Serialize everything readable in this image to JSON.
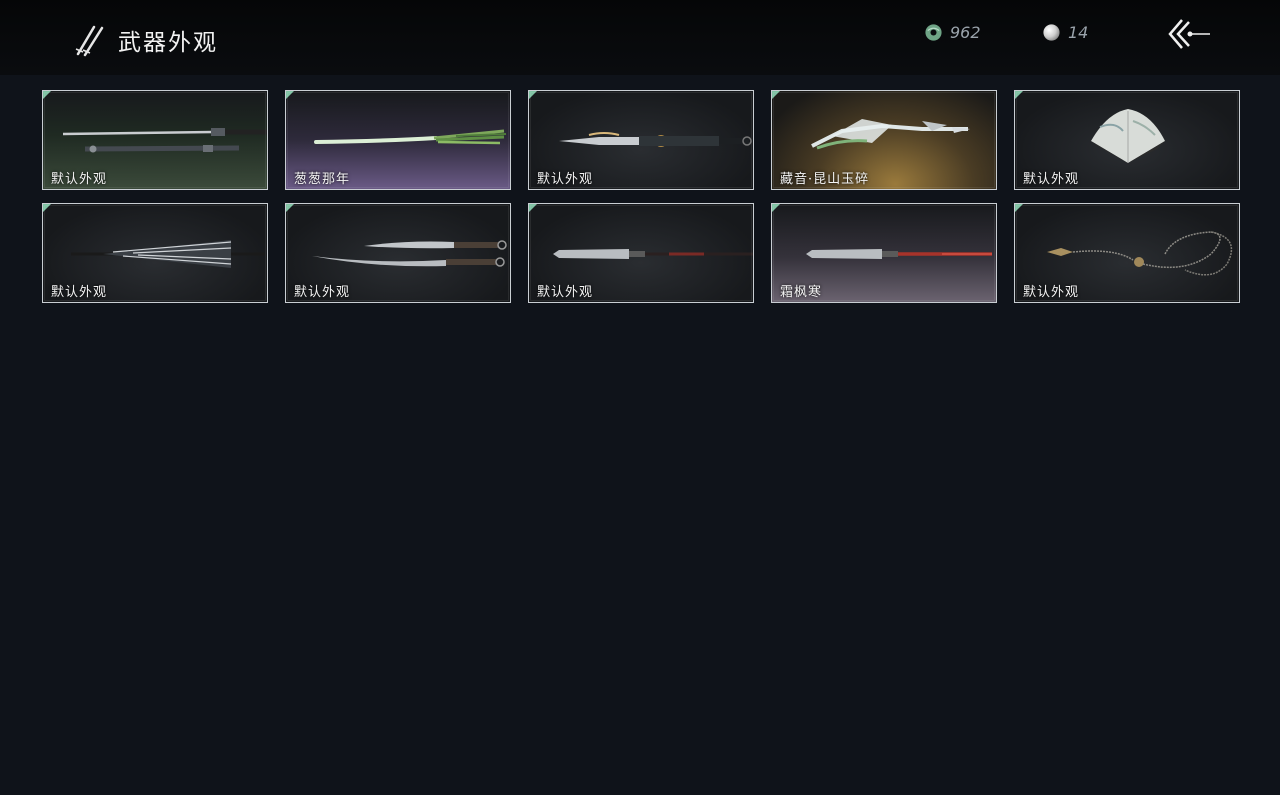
{
  "header": {
    "title": "武器外观",
    "jade_amount": "962",
    "pearl_amount": "14"
  },
  "weapons": [
    {
      "label": "默认外观",
      "icon": "sword-pair-icon"
    },
    {
      "label": "葱葱那年",
      "icon": "scallion-sword-icon"
    },
    {
      "label": "默认外观",
      "icon": "ornate-blade-icon"
    },
    {
      "label": "藏音·昆山玉碎",
      "icon": "jade-spear-icon"
    },
    {
      "label": "默认外观",
      "icon": "folding-fan-icon"
    },
    {
      "label": "默认外观",
      "icon": "umbrella-icon"
    },
    {
      "label": "默认外观",
      "icon": "twin-dao-icon"
    },
    {
      "label": "默认外观",
      "icon": "glaive-icon"
    },
    {
      "label": "霜枫寒",
      "icon": "red-glaive-icon"
    },
    {
      "label": "默认外观",
      "icon": "rope-dart-icon"
    }
  ],
  "colors": {
    "accent_corner": "#7fc2a3",
    "background": "#0f131a",
    "card_border": "#c9ced3"
  }
}
